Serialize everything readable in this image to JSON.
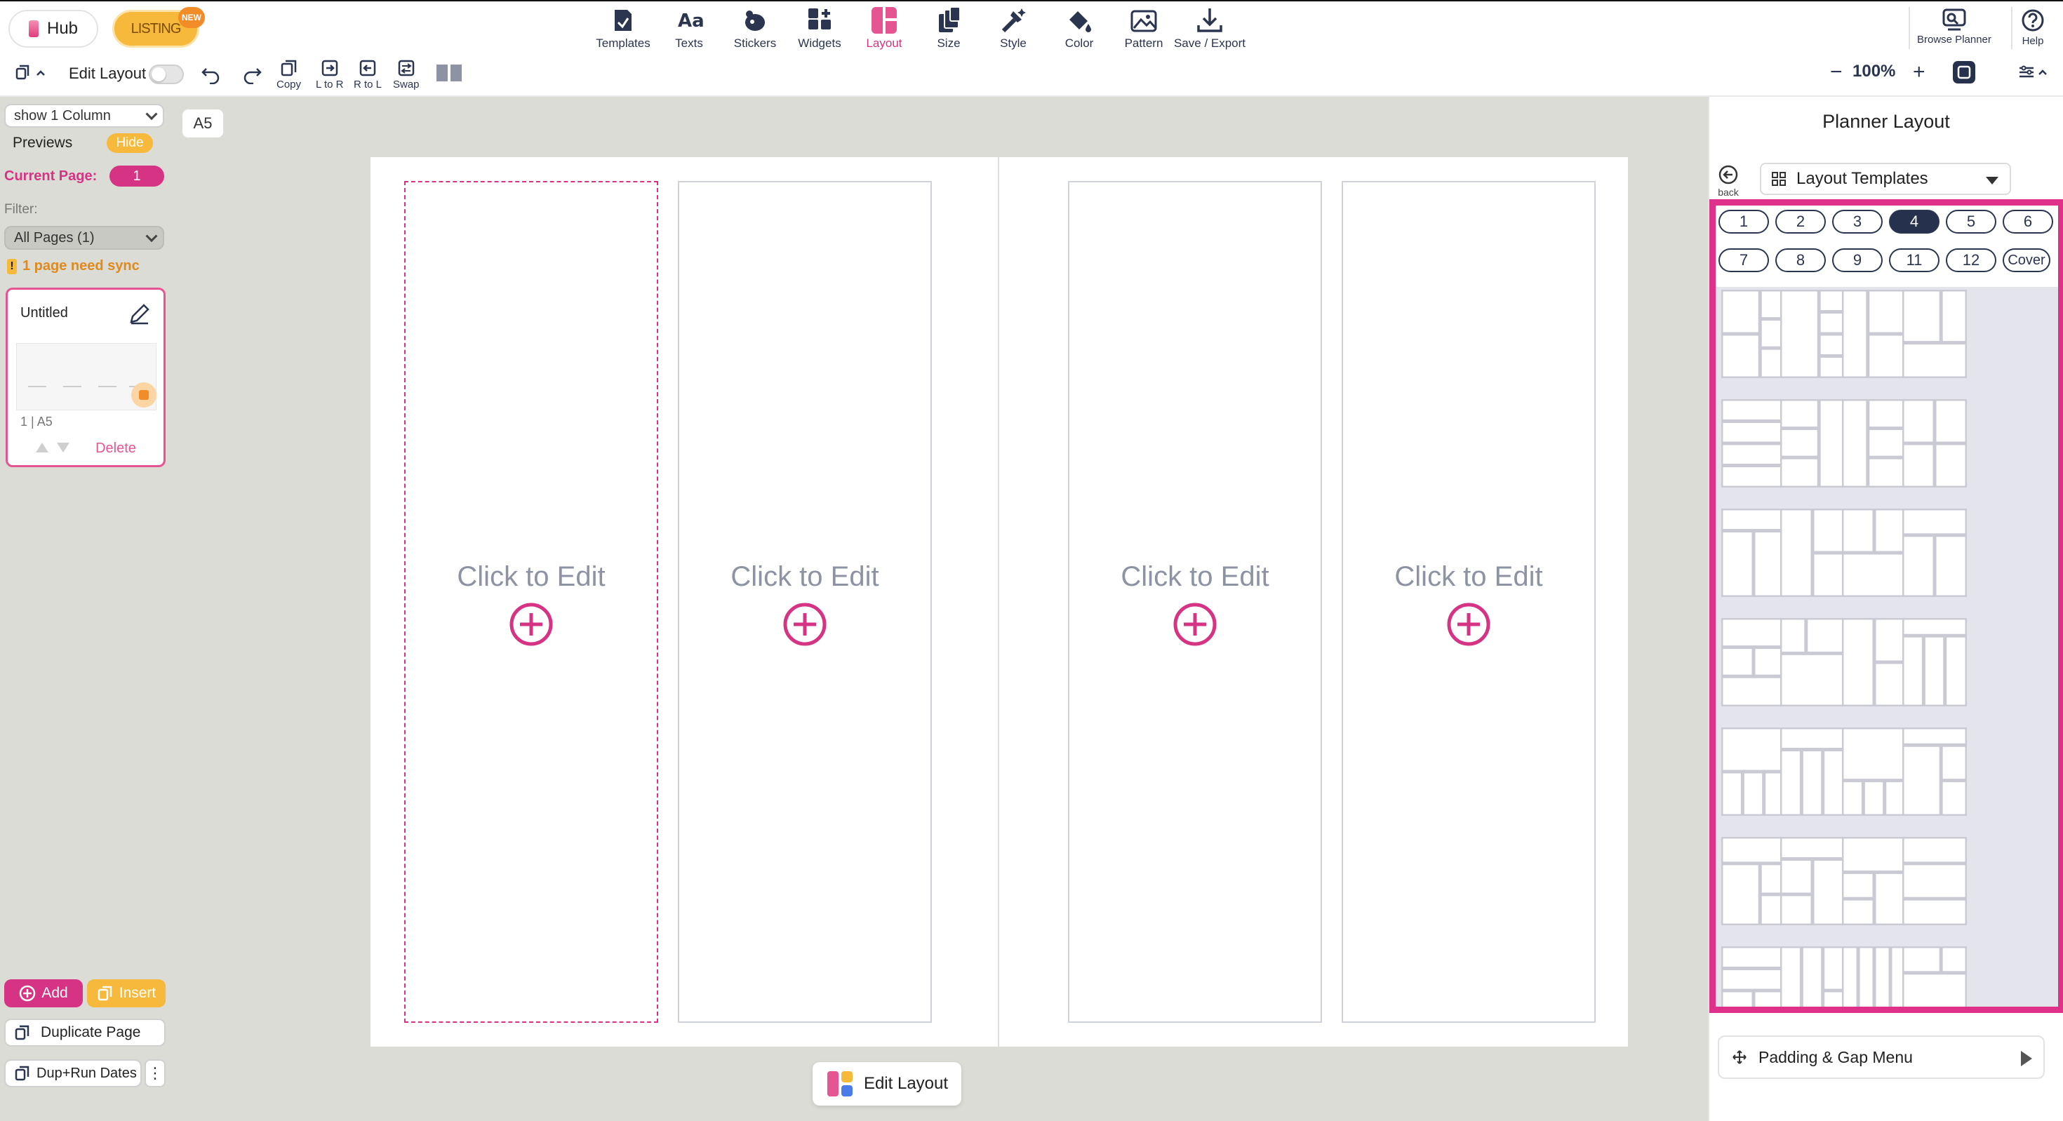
{
  "topbar": {
    "hub_label": "Hub",
    "listing_label": "LISTING",
    "new_badge": "NEW",
    "tools": [
      {
        "label": "Templates",
        "icon": "templates-icon"
      },
      {
        "label": "Texts",
        "icon": "texts-icon"
      },
      {
        "label": "Stickers",
        "icon": "stickers-icon"
      },
      {
        "label": "Widgets",
        "icon": "widgets-icon"
      },
      {
        "label": "Layout",
        "icon": "layout-icon"
      },
      {
        "label": "Size",
        "icon": "size-icon"
      },
      {
        "label": "Style",
        "icon": "style-icon"
      },
      {
        "label": "Color",
        "icon": "color-icon"
      },
      {
        "label": "Pattern",
        "icon": "pattern-icon"
      },
      {
        "label": "Save / Export",
        "icon": "save-export-icon"
      }
    ],
    "active_tool": "Layout",
    "browse_planner_label": "Browse Planner",
    "help_label": "Help",
    "texts_glyph": "Aa"
  },
  "subbar": {
    "edit_layout_label": "Edit Layout",
    "copy_label": "Copy",
    "l_to_r_label": "L to R",
    "r_to_l_label": "R to L",
    "swap_label": "Swap",
    "zoom_minus": "−",
    "zoom_value": "100%",
    "zoom_plus": "+"
  },
  "sidebar": {
    "column_select": "show 1 Column",
    "previews_label": "Previews",
    "hide_label": "Hide",
    "current_page_label": "Current Page:",
    "current_page_value": "1",
    "filter_label": "Filter:",
    "filter_value": "All Pages (1)",
    "sync_warn_glyph": "!",
    "sync_note": "1 page need sync",
    "card": {
      "title": "Untitled",
      "meta": "1 | A5",
      "delete_label": "Delete"
    },
    "add_label": "Add",
    "insert_label": "Insert",
    "duplicate_label": "Duplicate Page",
    "dup_run_label": "Dup+Run Dates",
    "more_glyph": "⋮"
  },
  "canvas": {
    "size_label": "A5",
    "columns": [
      {
        "text": "Click to Edit"
      },
      {
        "text": "Click to Edit"
      },
      {
        "text": "Click to Edit"
      },
      {
        "text": "Click to Edit"
      }
    ],
    "edit_layout_button": "Edit Layout"
  },
  "rpanel": {
    "title": "Planner Layout",
    "back_label": "back",
    "template_select": "Layout Templates",
    "pills": [
      "1",
      "2",
      "3",
      "4",
      "5",
      "6",
      "7",
      "8",
      "9",
      "11",
      "12",
      "Cover"
    ],
    "active_pill": "4",
    "padding_menu": "Padding & Gap Menu"
  },
  "colors": {
    "accent": "#d63384",
    "frame": "#e0318a",
    "listing": "#f6b93b",
    "navy": "#26324d"
  }
}
